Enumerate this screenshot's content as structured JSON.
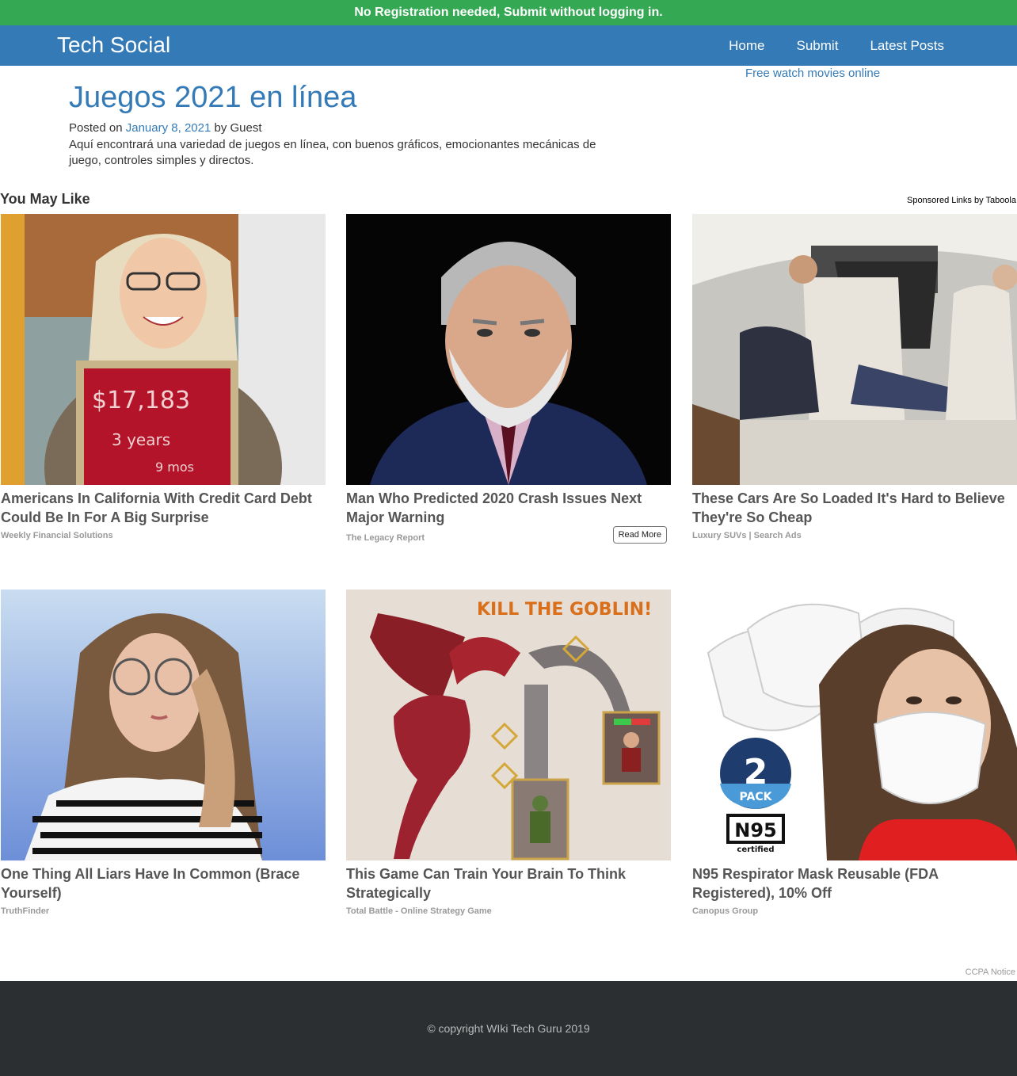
{
  "topbar": {
    "text": "No Registration needed, Submit without logging in."
  },
  "navbar": {
    "brand": "Tech Social",
    "links": [
      "Home",
      "Submit",
      "Latest Posts"
    ]
  },
  "sidebar": {
    "link": "Free watch movies online"
  },
  "post": {
    "title": "Juegos 2021 en línea",
    "posted_on": "Posted on",
    "date": "January 8, 2021",
    "by": "by",
    "author": "Guest",
    "excerpt": "Aquí encontrará una variedad de juegos en línea, con buenos gráficos, emocionantes mecánicas de juego, controles simples y directos."
  },
  "widget": {
    "heading": "You May Like",
    "sponsored": "Sponsored Links by Taboola",
    "read_more": "Read More",
    "cards": [
      {
        "title": "Americans In California With Credit Card Debt Could Be In For A Big Surprise",
        "source": "Weekly Financial Solutions",
        "sign_amount": "$17,183",
        "sign_years": "3 years",
        "sign_mos": "9 mos"
      },
      {
        "title": "Man Who Predicted 2020 Crash Issues Next Major Warning",
        "source": "The Legacy Report"
      },
      {
        "title": "These Cars Are So Loaded It's Hard to Believe They're So Cheap",
        "source": "Luxury SUVs | Search Ads"
      },
      {
        "title": "One Thing All Liars Have In Common (Brace Yourself)",
        "source": "TruthFinder"
      },
      {
        "title": "This Game Can Train Your Brain To Think Strategically",
        "source": "Total Battle - Online Strategy Game",
        "banner": "KILL THE GOBLIN!"
      },
      {
        "title": "N95 Respirator Mask Reusable (FDA Registered), 10% Off",
        "source": "Canopus Group",
        "badge_num": "2",
        "badge_word": "PACK",
        "n95": "N95",
        "certified": "certified"
      }
    ]
  },
  "ccpa": "CCPA Notice",
  "footer": {
    "copyright": "© copyright WIki Tech Guru 2019"
  }
}
